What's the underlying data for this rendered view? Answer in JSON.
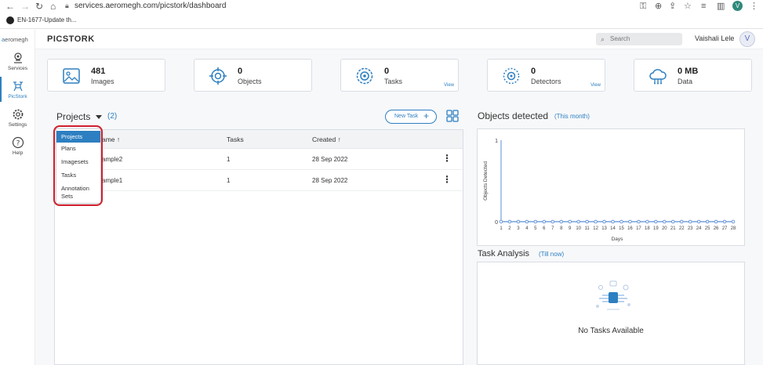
{
  "browser": {
    "url": "services.aeromegh.com/picstork/dashboard",
    "bookmark": "EN-1677-Update th...",
    "profile_initial": "V"
  },
  "sidebar": {
    "logo_prefix": "a",
    "logo_text": "eromegh",
    "items": [
      {
        "label": "Services",
        "icon": "services-icon"
      },
      {
        "label": "PicStork",
        "icon": "picstork-drone-icon"
      },
      {
        "label": "Settings",
        "icon": "gear-icon"
      },
      {
        "label": "Help",
        "icon": "help-icon"
      }
    ]
  },
  "header": {
    "title": "PICSTORK",
    "search_placeholder": "Search",
    "username": "Vaishali Lele",
    "avatar_initial": "V"
  },
  "stats": [
    {
      "value": "481",
      "label": "Images",
      "icon": "image-icon",
      "view": ""
    },
    {
      "value": "0",
      "label": "Objects",
      "icon": "target-icon",
      "view": ""
    },
    {
      "value": "0",
      "label": "Tasks",
      "icon": "tasks-icon",
      "view": "View"
    },
    {
      "value": "0",
      "label": "Detectors",
      "icon": "detector-icon",
      "view": "View"
    },
    {
      "value": "0 MB",
      "label": "Data",
      "icon": "cloud-icon",
      "view": ""
    }
  ],
  "projects": {
    "title": "Projects",
    "count": "(2)",
    "new_task_label": "New Task",
    "columns": [
      "ame",
      "Tasks",
      "Created"
    ],
    "rows": [
      {
        "name": "ample2",
        "tasks": "1",
        "created": "28 Sep 2022"
      },
      {
        "name": "ample1",
        "tasks": "1",
        "created": "28 Sep 2022"
      }
    ],
    "dropdown": [
      "Projects",
      "Plans",
      "Imagesets",
      "Tasks",
      "Annotation",
      "Sets"
    ]
  },
  "objects_panel": {
    "title": "Objects detected",
    "subtitle": "(This month)"
  },
  "task_panel": {
    "title": "Task Analysis",
    "subtitle": "(Till now)",
    "empty": "No Tasks Available"
  },
  "chart_data": {
    "type": "line",
    "title": "",
    "xlabel": "Days",
    "ylabel": "Objects Detected",
    "x": [
      1,
      2,
      3,
      4,
      5,
      6,
      7,
      8,
      9,
      10,
      11,
      12,
      13,
      14,
      15,
      16,
      17,
      18,
      19,
      20,
      21,
      22,
      23,
      24,
      25,
      26,
      27,
      28
    ],
    "series": [
      {
        "values": [
          0,
          0,
          0,
          0,
          0,
          0,
          0,
          0,
          0,
          0,
          0,
          0,
          0,
          0,
          0,
          0,
          0,
          0,
          0,
          0,
          0,
          0,
          0,
          0,
          0,
          0,
          0,
          0
        ]
      }
    ],
    "ylim": [
      0,
      1
    ],
    "yticks": [
      0,
      1
    ],
    "color": "#5b8fd6",
    "grid": false
  }
}
